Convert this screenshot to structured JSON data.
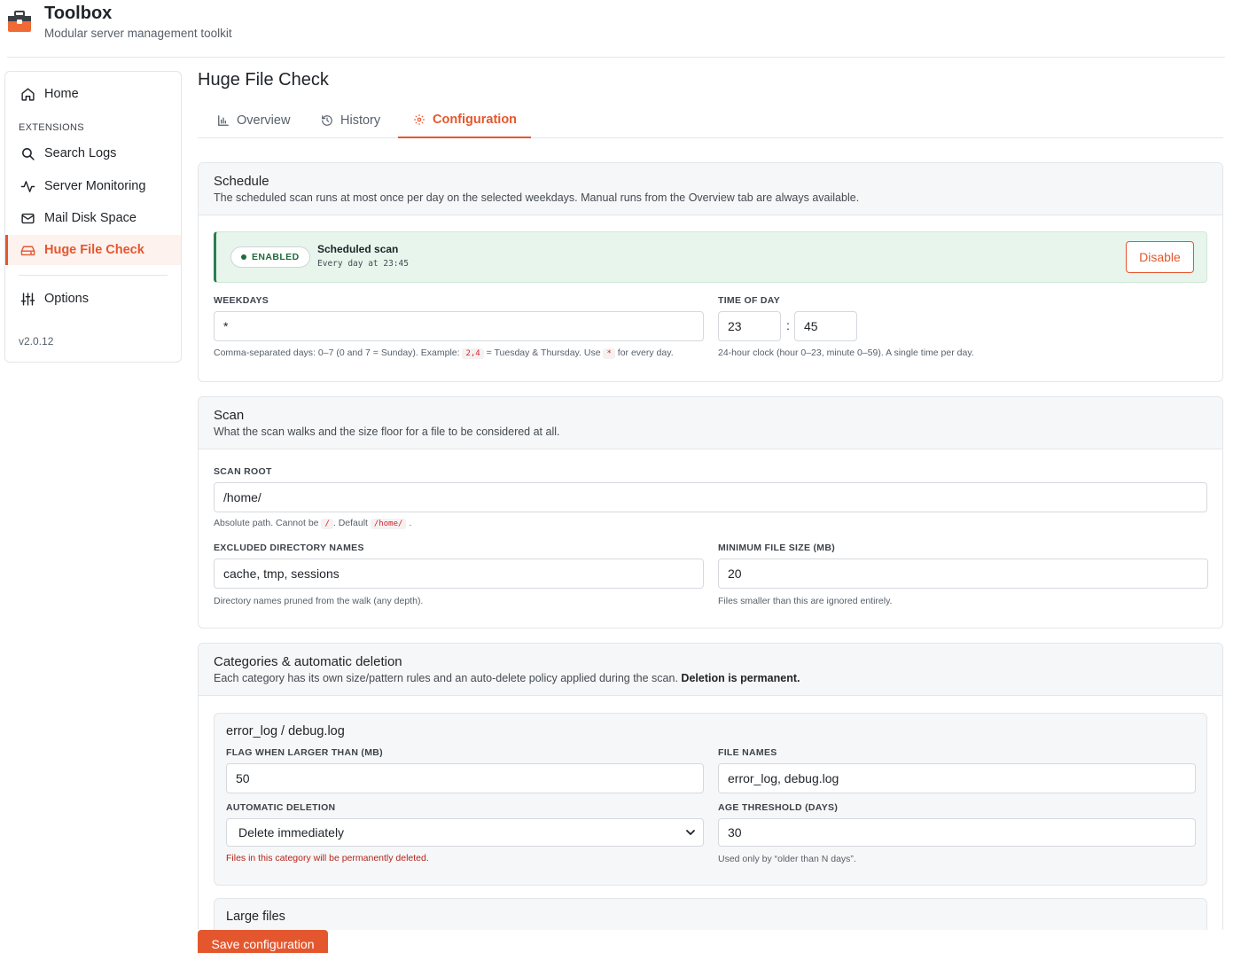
{
  "app": {
    "title": "Toolbox",
    "subtitle": "Modular server management toolkit",
    "icon": "toolbox-icon",
    "accent": "#e4572e"
  },
  "sidebar": {
    "home_label": "Home",
    "section_label": "EXTENSIONS",
    "items": [
      {
        "label": "Search Logs",
        "icon": "search-icon"
      },
      {
        "label": "Server Monitoring",
        "icon": "activity-icon"
      },
      {
        "label": "Mail Disk Space",
        "icon": "mail-icon"
      },
      {
        "label": "Huge File Check",
        "icon": "hard-drive-icon",
        "active": true
      }
    ],
    "options_label": "Options",
    "version": "v2.0.12"
  },
  "page": {
    "title": "Huge File Check",
    "tabs": [
      {
        "label": "Overview",
        "icon": "bar-chart-icon"
      },
      {
        "label": "History",
        "icon": "history-icon"
      },
      {
        "label": "Configuration",
        "icon": "gear-icon",
        "active": true
      }
    ]
  },
  "schedule": {
    "title": "Schedule",
    "description": "The scheduled scan runs at most once per day on the selected weekdays. Manual runs from the Overview tab are always available.",
    "status_badge": "ENABLED",
    "status_title": "Scheduled scan",
    "status_detail": "Every day at 23:45",
    "disable_label": "Disable",
    "weekdays_label": "WEEKDAYS",
    "weekdays_value": "*",
    "weekdays_help_1": "Comma-separated days: 0–7 (0 and 7 = Sunday). Example:",
    "weekdays_help_code_1": "2,4",
    "weekdays_help_2": "= Tuesday & Thursday. Use",
    "weekdays_help_code_2": "*",
    "weekdays_help_3": "for every day.",
    "time_label": "TIME OF DAY",
    "hour": "23",
    "colon": ":",
    "minute": "45",
    "time_help": "24-hour clock (hour 0–23, minute 0–59). A single time per day."
  },
  "scan": {
    "title": "Scan",
    "description": "What the scan walks and the size floor for a file to be considered at all.",
    "root_label": "SCAN ROOT",
    "root_value": "/home/",
    "root_help_1": "Absolute path. Cannot be",
    "root_help_code_1": "/",
    "root_help_2": ". Default",
    "root_help_code_2": "/home/",
    "root_help_3": ".",
    "excluded_label": "EXCLUDED DIRECTORY NAMES",
    "excluded_value": "cache, tmp, sessions",
    "excluded_help": "Directory names pruned from the walk (any depth).",
    "min_size_label": "MINIMUM FILE SIZE (MB)",
    "min_size_value": "20",
    "min_size_help": "Files smaller than this are ignored entirely."
  },
  "categories": {
    "title": "Categories & automatic deletion",
    "description": "Each category has its own size/pattern rules and an auto-delete policy applied during the scan.",
    "description_bold": "Deletion is permanent.",
    "items": [
      {
        "name": "error_log / debug.log",
        "flag_label": "FLAG WHEN LARGER THAN (MB)",
        "flag_value": "50",
        "names_label": "FILE NAMES",
        "names_value": "error_log, debug.log",
        "deletion_label": "AUTOMATIC DELETION",
        "deletion_value": "Delete immediately",
        "deletion_help": "Files in this category will be permanently deleted.",
        "age_label": "AGE THRESHOLD (DAYS)",
        "age_value": "30",
        "age_help": "Used only by “older than N days”."
      },
      {
        "name": "Large files"
      }
    ]
  },
  "footer": {
    "save_label": "Save configuration"
  }
}
